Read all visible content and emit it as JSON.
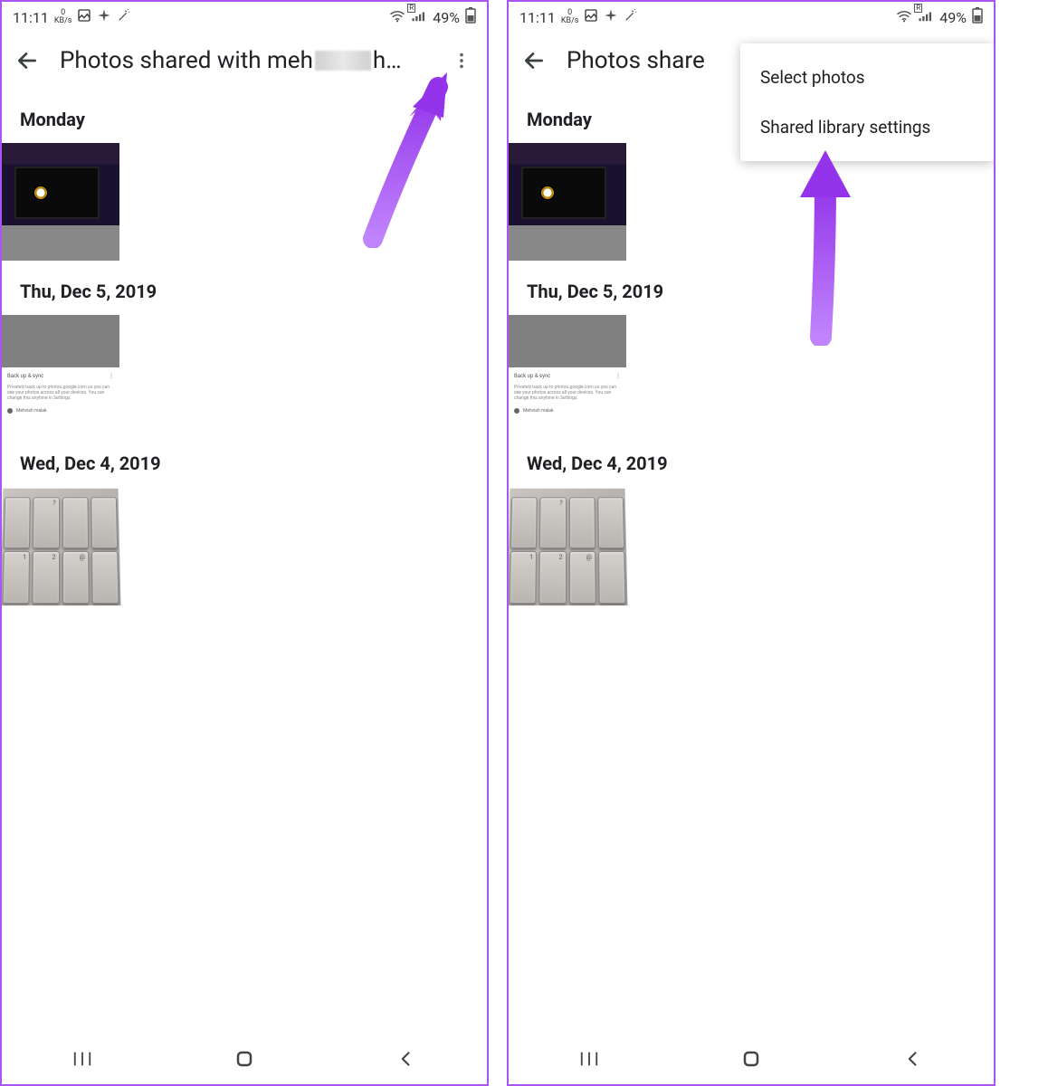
{
  "statusbar": {
    "time": "11:11",
    "netspeed_value": "0",
    "netspeed_unit": "KB/s",
    "battery_pct": "49%"
  },
  "appbar": {
    "title_left": "Photos shared with meh",
    "title_left_b": "Photos share",
    "title_right": "h…"
  },
  "sections": {
    "0": {
      "header": "Monday"
    },
    "1": {
      "header": "Thu, Dec 5, 2019"
    },
    "2": {
      "header": "Wed, Dec 4, 2019"
    }
  },
  "thumb_screenshot": {
    "label": "Back up & sync",
    "desc": "Privately back up to photos.google.com so you can see your photos across all your devices. You can change this anytime in Settings.",
    "footer": "Mehvish malak"
  },
  "menu": {
    "items": {
      "0": {
        "label": "Select photos"
      },
      "1": {
        "label": "Shared library settings"
      }
    }
  }
}
